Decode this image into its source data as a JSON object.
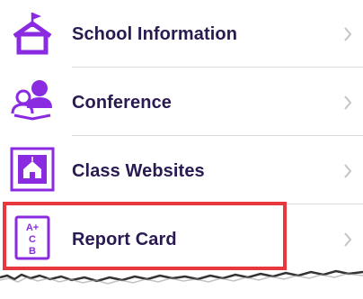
{
  "menu": {
    "items": [
      {
        "label": "School Information",
        "icon": "school-house-icon"
      },
      {
        "label": "Conference",
        "icon": "conference-people-icon"
      },
      {
        "label": "Class Websites",
        "icon": "class-website-icon"
      },
      {
        "label": "Report Card",
        "icon": "report-card-icon",
        "icon_text": [
          "A+",
          "C",
          "B"
        ]
      }
    ],
    "chevron_icon": "chevron-right-icon",
    "highlighted_item": "Report Card"
  },
  "colors": {
    "accent_purple": "#8a2be2",
    "label_text": "#2a1a52",
    "highlight_border": "#e8373d",
    "chevron": "#c4c4c8",
    "divider": "#dcdce0"
  }
}
